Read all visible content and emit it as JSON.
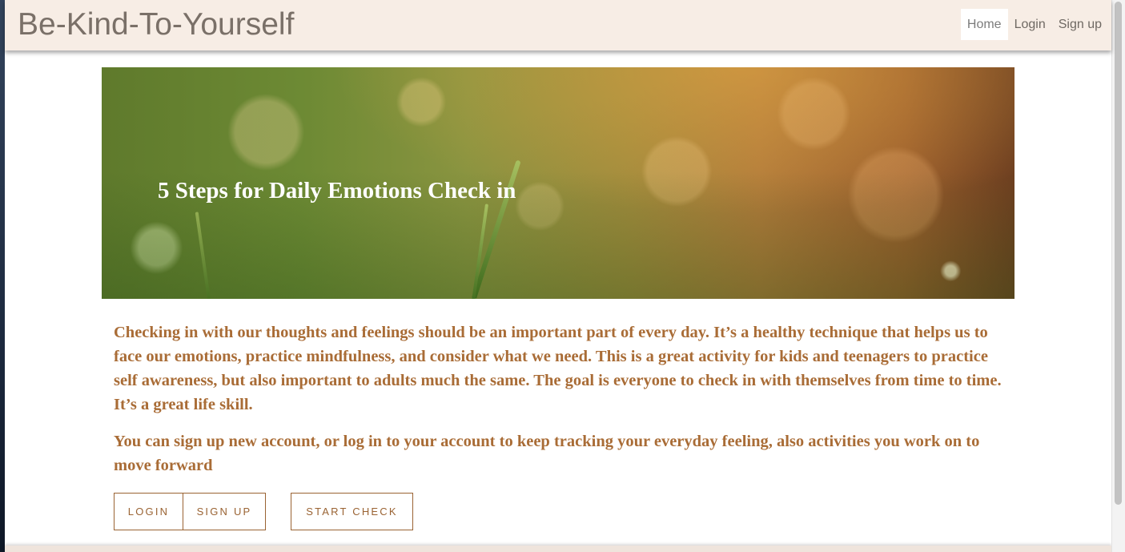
{
  "navbar": {
    "brand": "Be-Kind-To-Yourself",
    "links": [
      {
        "label": "Home",
        "active": true
      },
      {
        "label": "Login",
        "active": false
      },
      {
        "label": "Sign up",
        "active": false
      }
    ]
  },
  "hero": {
    "title": "5 Steps for Daily Emotions Check in"
  },
  "main": {
    "intro": "Checking in with our thoughts and feelings should be an important part of every day. It’s a healthy technique that helps us to face our emotions, practice mindfulness, and consider what we need. This is a great activity for kids and teenagers to practice self awareness, but also important to adults much the same. The goal is everyone to check in with themselves from time to time. It’s a great life skill.",
    "account_note": "You can sign up new account, or log in to your account to keep tracking your everyday feeling, also activities you work on to move forward",
    "buttons": {
      "login": "LOGIN",
      "signup": "SIGN UP",
      "start": "START CHECK"
    }
  },
  "colors": {
    "navbar_bg": "#f7ede5",
    "accent_text": "#a96c36",
    "button_border": "#9a6333"
  }
}
